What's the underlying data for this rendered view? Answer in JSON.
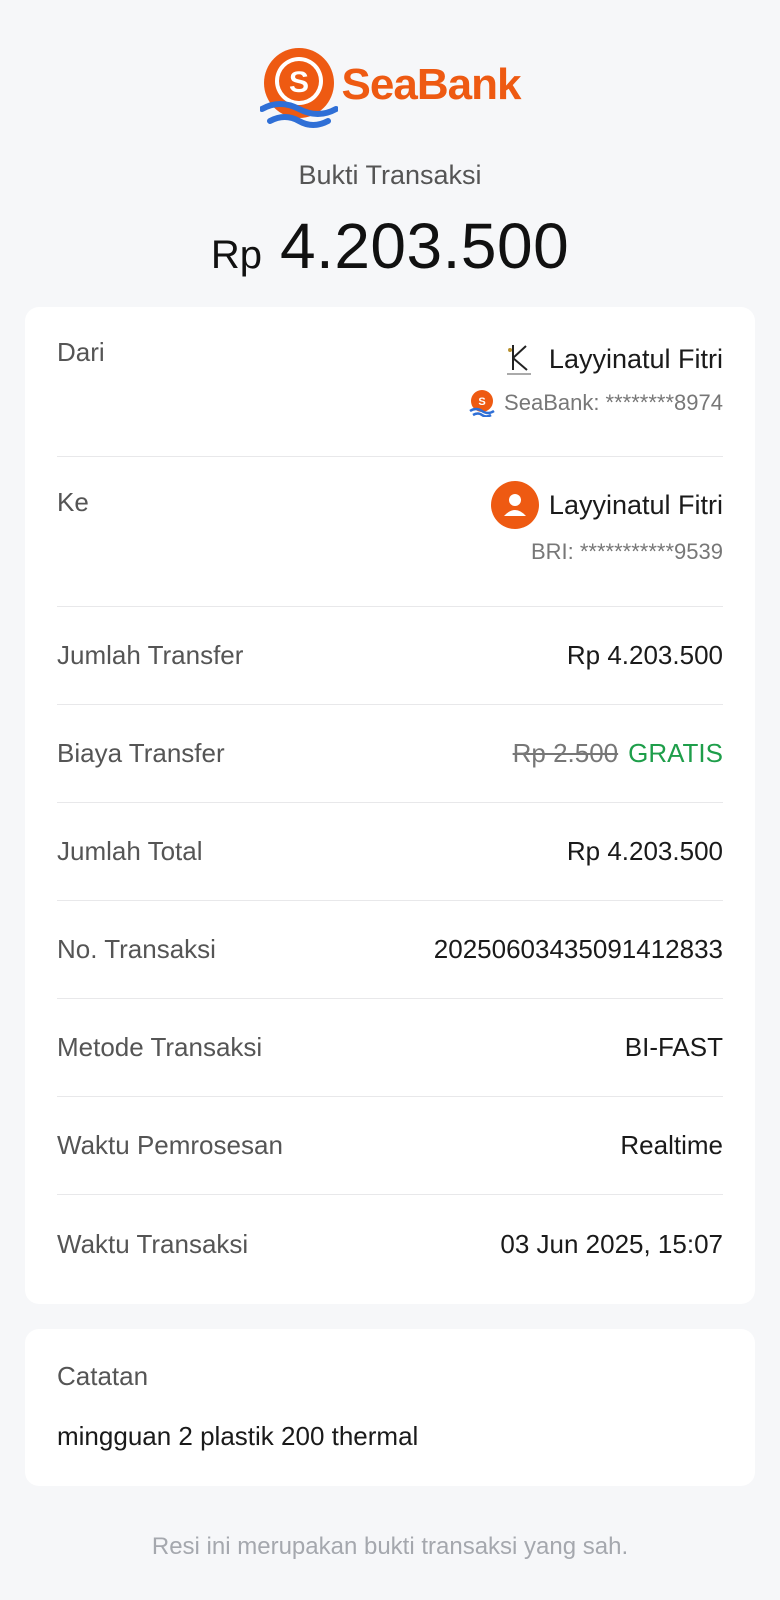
{
  "brand": {
    "name": "SeaBank",
    "accent": "#ee5a12",
    "wave": "#2f6fd6"
  },
  "header": {
    "subtitle": "Bukti Transaksi",
    "currency": "Rp",
    "amount": "4.203.500"
  },
  "from": {
    "label": "Dari",
    "name": "Layyinatul Fitri",
    "account": "SeaBank: ********8974",
    "avatar": "k-logo-icon",
    "bank_icon": "seabank-icon"
  },
  "to": {
    "label": "Ke",
    "name": "Layyinatul Fitri",
    "account": "BRI: ***********9539",
    "avatar": "person-icon"
  },
  "details": {
    "transfer_amount": {
      "label": "Jumlah Transfer",
      "value": "Rp 4.203.500"
    },
    "transfer_fee": {
      "label": "Biaya Transfer",
      "original": "Rp 2.500",
      "value": "GRATIS",
      "value_color": "#1e9e4a"
    },
    "total": {
      "label": "Jumlah Total",
      "value": "Rp 4.203.500"
    },
    "transaction_no": {
      "label": "No. Transaksi",
      "value": "20250603435091412833"
    },
    "method": {
      "label": "Metode Transaksi",
      "value": "BI-FAST"
    },
    "processing_time": {
      "label": "Waktu Pemrosesan",
      "value": "Realtime"
    },
    "transaction_time": {
      "label": "Waktu Transaksi",
      "value": "03 Jun 2025, 15:07"
    }
  },
  "note": {
    "label": "Catatan",
    "text": "mingguan 2 plastik 200 thermal"
  },
  "footer": "Resi ini merupakan bukti transaksi yang sah."
}
